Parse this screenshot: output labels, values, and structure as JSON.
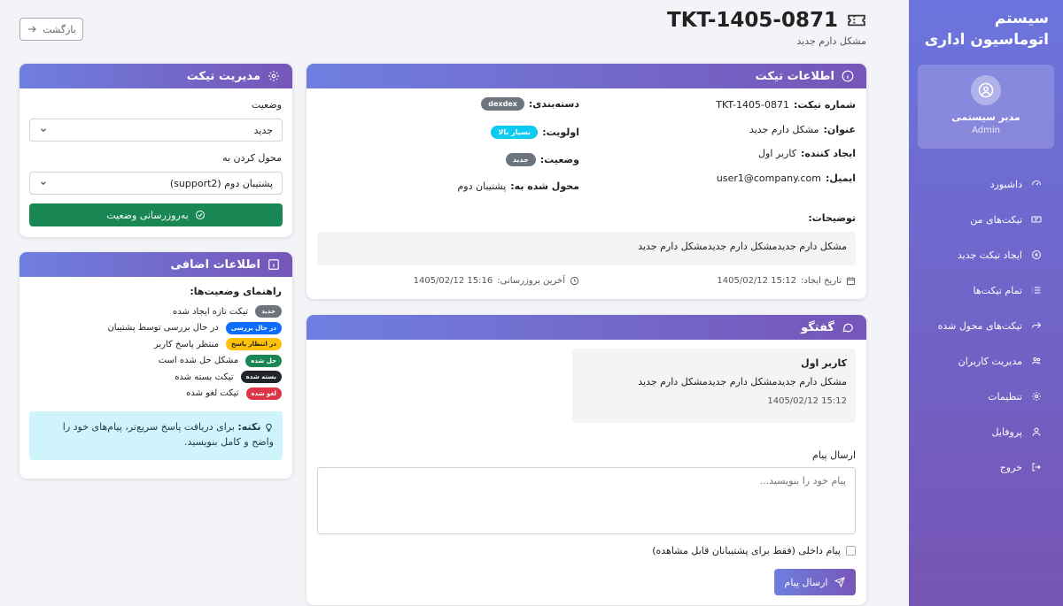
{
  "sidebar": {
    "brand": "سیستم اتوماسیون اداری",
    "user_name": "مدیر سیستمی",
    "user_role": "Admin",
    "items": [
      {
        "label": "داشبورد",
        "icon": "dashboard-icon"
      },
      {
        "label": "تیکت‌های من",
        "icon": "ticket-icon"
      },
      {
        "label": "ایجاد تیکت جدید",
        "icon": "plus-circle-icon"
      },
      {
        "label": "تمام تیکت‌ها",
        "icon": "list-icon"
      },
      {
        "label": "تیکت‌های محول شده",
        "icon": "forward-icon"
      },
      {
        "label": "مدیریت کاربران",
        "icon": "users-icon"
      },
      {
        "label": "تنظیمات",
        "icon": "gear-icon"
      },
      {
        "label": "پروفایل",
        "icon": "user-icon"
      },
      {
        "label": "خروج",
        "icon": "logout-icon"
      }
    ]
  },
  "header": {
    "back_label": "بازگشت",
    "ticket_id": "TKT-1405-0871",
    "subtitle": "مشکل دارم جدید"
  },
  "info": {
    "title": "اطلاعات تیکت",
    "number_label": "شماره تیکت:",
    "number_value": "TKT-1405-0871",
    "subject_label": "عنوان:",
    "subject_value": "مشکل دارم جدید",
    "creator_label": "ایجاد کننده:",
    "creator_value": "کاربر اول",
    "email_label": "ایمیل:",
    "email_value": "user1@company.com",
    "category_label": "دسته‌بندی:",
    "category_value": "dexdex",
    "priority_label": "اولویت:",
    "priority_value": "بسیار بالا",
    "status_label": "وضعیت:",
    "status_value": "جدید",
    "assigned_label": "محول شده به:",
    "assigned_value": "پشتیبان دوم",
    "desc_label": "توضیحات:",
    "desc_value": "مشکل دارم جدیدمشکل دارم جدیدمشکل دارم جدید",
    "created_label": "تاریخ ایجاد:",
    "created_value": "1405/02/12 15:12",
    "updated_label": "آخرین بروزرسانی:",
    "updated_value": "1405/02/12 15:16"
  },
  "chat": {
    "title": "گفتگو",
    "msg_author": "کاربر اول",
    "msg_text": "مشکل دارم جدیدمشکل دارم جدیدمشکل دارم جدید",
    "msg_time": "1405/02/12 15:12",
    "send_label": "ارسال پیام",
    "placeholder": "پیام خود را بنویسید...",
    "internal_label": "پیام داخلی (فقط برای پشتیبانان قابل مشاهده)",
    "send_button": "ارسال پیام"
  },
  "mgmt": {
    "title": "مدیریت تیکت",
    "status_label": "وضعیت",
    "status_value": "جدید",
    "assign_label": "محول کردن به",
    "assign_value": "پشتیبان دوم (support2)",
    "update_button": "به‌روزرسانی وضعیت"
  },
  "extra": {
    "title": "اطلاعات اضافی",
    "guide_title": "راهنمای وضعیت‌ها:",
    "legend": [
      {
        "badge": "جدید",
        "text": "تیکت تازه ایجاد شده",
        "color": "#6c757d"
      },
      {
        "badge": "در حال بررسی",
        "text": "در حال بررسی توسط پشتیبان",
        "color": "#0d6efd"
      },
      {
        "badge": "در انتظار پاسخ",
        "text": "منتظر پاسخ کاربر",
        "color": "#ffc107"
      },
      {
        "badge": "حل شده",
        "text": "مشکل حل شده است",
        "color": "#198754"
      },
      {
        "badge": "بسته شده",
        "text": "تیکت بسته شده",
        "color": "#212529"
      },
      {
        "badge": "لغو شده",
        "text": "تیکت لغو شده",
        "color": "#dc3545"
      }
    ],
    "note_title": "نکته:",
    "note_text": "برای دریافت پاسخ سریع‌تر، پیام‌های خود را واضح و کامل بنویسید."
  },
  "colors": {
    "accent_start": "#6f7fe0",
    "accent_end": "#7656b8",
    "success": "#198754",
    "info_priority": "#0dcaf0",
    "badge_gray": "#6c757d"
  }
}
